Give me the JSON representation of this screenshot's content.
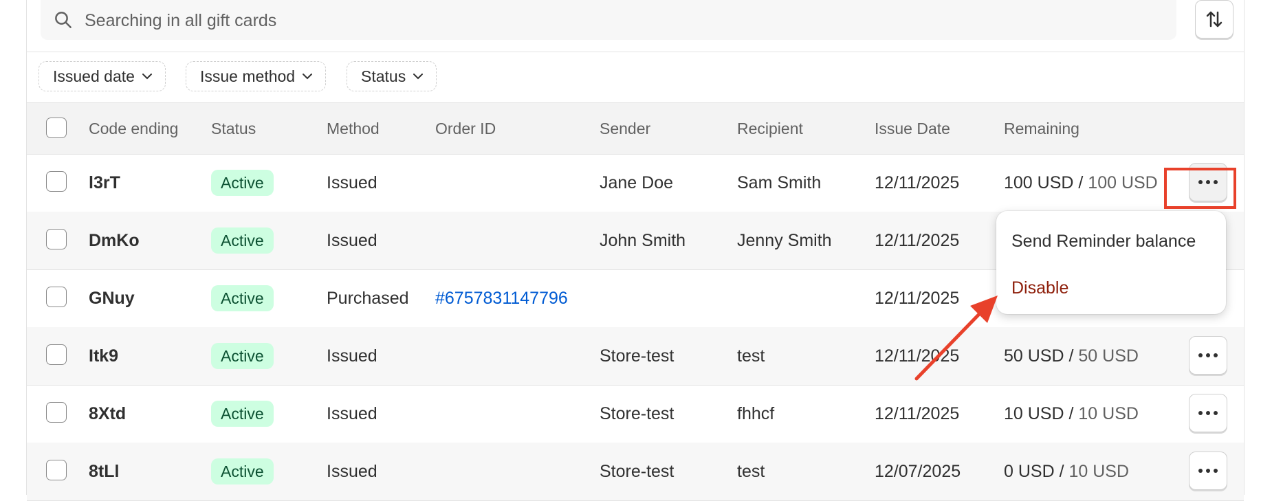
{
  "search": {
    "placeholder": "Searching in all gift cards",
    "icon": "search-icon"
  },
  "sort_button": {
    "icon": "sort-arrows-icon"
  },
  "filters": [
    {
      "label": "Issued date"
    },
    {
      "label": "Issue method"
    },
    {
      "label": "Status"
    }
  ],
  "table": {
    "headers": [
      "Code ending",
      "Status",
      "Method",
      "Order ID",
      "Sender",
      "Recipient",
      "Issue Date",
      "Remaining"
    ],
    "rows": [
      {
        "code": "l3rT",
        "status": "Active",
        "method": "Issued",
        "order_id": "",
        "sender": "Jane Doe",
        "recipient": "Sam Smith",
        "issue_date": "12/11/2025",
        "remaining": "100 USD",
        "remaining_sep": " / ",
        "initial": "100 USD"
      },
      {
        "code": "DmKo",
        "status": "Active",
        "method": "Issued",
        "order_id": "",
        "sender": "John Smith",
        "recipient": "Jenny Smith",
        "issue_date": "12/11/2025",
        "remaining": "",
        "remaining_sep": "",
        "initial": ""
      },
      {
        "code": "GNuy",
        "status": "Active",
        "method": "Purchased",
        "order_id": "#6757831147796",
        "sender": "",
        "recipient": "",
        "issue_date": "12/11/2025",
        "remaining": "",
        "remaining_sep": "",
        "initial": ""
      },
      {
        "code": "Itk9",
        "status": "Active",
        "method": "Issued",
        "order_id": "",
        "sender": "Store-test",
        "recipient": "test",
        "issue_date": "12/11/2025",
        "remaining": "50 USD",
        "remaining_sep": " / ",
        "initial": "50 USD"
      },
      {
        "code": "8Xtd",
        "status": "Active",
        "method": "Issued",
        "order_id": "",
        "sender": "Store-test",
        "recipient": "fhhcf",
        "issue_date": "12/11/2025",
        "remaining": "10 USD",
        "remaining_sep": " / ",
        "initial": "10 USD"
      },
      {
        "code": "8tLl",
        "status": "Active",
        "method": "Issued",
        "order_id": "",
        "sender": "Store-test",
        "recipient": "test",
        "issue_date": "12/07/2025",
        "remaining": "0 USD",
        "remaining_sep": " / ",
        "initial": "10 USD"
      }
    ]
  },
  "action_menu": {
    "items": [
      {
        "label": "Send Reminder balance"
      },
      {
        "label": "Disable"
      }
    ]
  },
  "colors": {
    "badge_bg": "#cdfee1",
    "badge_text": "#0c5132",
    "link": "#005bd3",
    "disable": "#8e1f0b",
    "annotation": "#e8412b"
  }
}
